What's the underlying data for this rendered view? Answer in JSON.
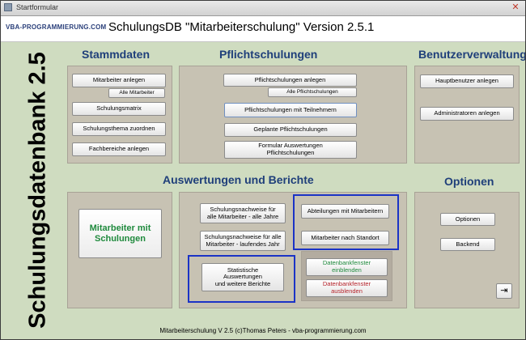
{
  "window": {
    "title": "Startformular",
    "close_glyph": "✕"
  },
  "header": {
    "logo": "VBA-PROGRAMMIERUNG.COM",
    "title": "SchulungsDB \"Mitarbeiterschulung\" Version 2.5.1"
  },
  "vertical_title": "Schulungsdatenbank 2.5",
  "sections": {
    "stammdaten": {
      "title": "Stammdaten",
      "mitarbeiter_anlegen": "Mitarbeiter anlegen",
      "alle_mitarbeiter": "Alle Mitarbeiter",
      "schulungsmatrix": "Schulungsmatrix",
      "schulungsthema_zuordnen": "Schulungsthema zuordnen",
      "fachbereiche_anlegen": "Fachbereiche anlegen"
    },
    "pflichtschulungen": {
      "title": "Pflichtschulungen",
      "anlegen": "Pflichtschulungen anlegen",
      "alle": "Alle Pflichtschulungen",
      "mit_teilnehmern": "Pflichtschulungen mit Teilnehmern",
      "geplante": "Geplante Pflichtschulungen",
      "formular_auswertungen": "Formular Auswertungen\nPflichtschulungen"
    },
    "benutzerverwaltung": {
      "title": "Benutzerverwaltung",
      "hauptbenutzer": "Hauptbenutzer anlegen",
      "administratoren": "Administratoren anlegen"
    },
    "auswertungen": {
      "title": "Auswertungen und Berichte",
      "mitarbeiter_mit_schulungen": "Mitarbeiter mit\nSchulungen",
      "nachweise_alle_jahre": "Schulungsnachweise für\nalle Mitarbeiter - alle Jahre",
      "nachweise_laufendes_jahr": "Schulungsnachweise für alle\nMitarbeiter - laufendes Jahr",
      "abteilungen_mit_mitarbeitern": "Abteilungen mit Mitarbeitern",
      "mitarbeiter_nach_standort": "Mitarbeiter nach Standort",
      "statistische_auswertungen": "Statistische\nAuswertungen\nund weitere Berichte",
      "dbfenster_einblenden": "Datenbankfenster\neinblenden",
      "dbfenster_ausblenden": "Datenbankfenster\nausblenden"
    },
    "optionen": {
      "title": "Optionen",
      "optionen": "Optionen",
      "backend": "Backend",
      "exit_glyph": "⇥"
    }
  },
  "footer": "Mitarbeiterschulung V 2.5  (c)Thomas Peters - vba-programmierung.com",
  "colors": {
    "section_title": "#1f3f7a",
    "panel": "#c7c2b3",
    "background": "#cfdcc0",
    "highlight": "#1b33c6",
    "green_text": "#1f8a3d",
    "red_text": "#b5222a"
  }
}
